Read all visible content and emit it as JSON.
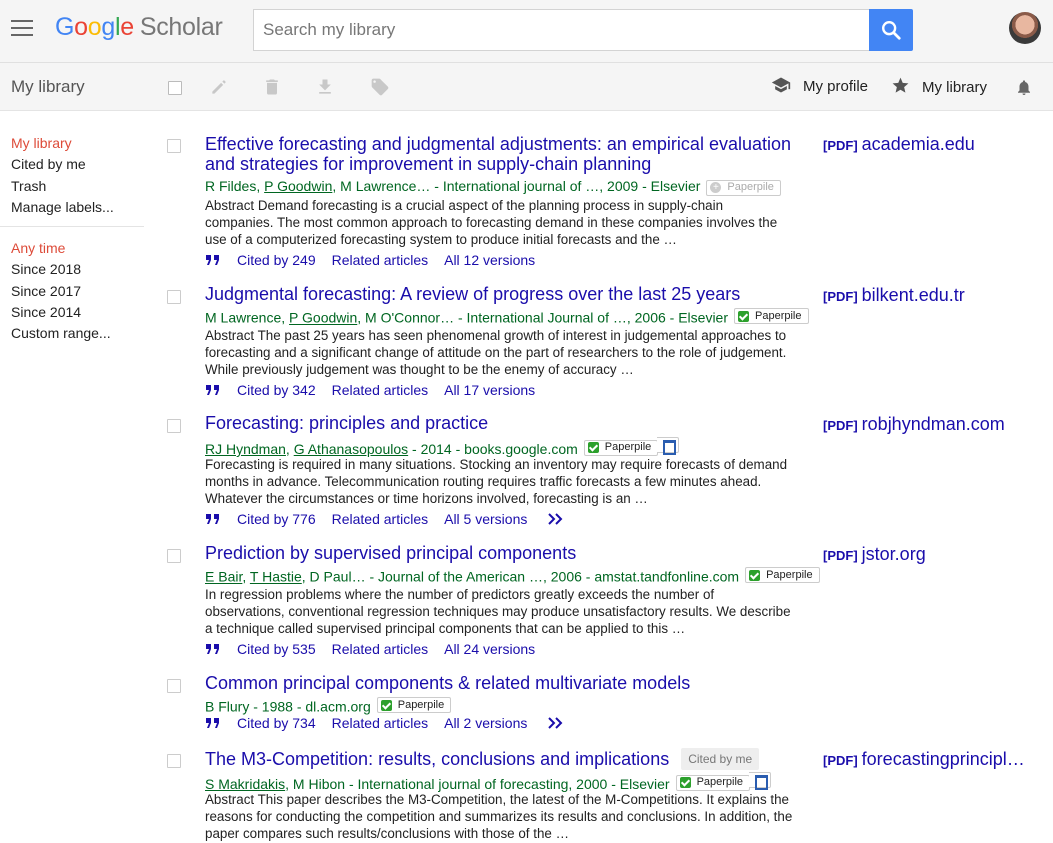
{
  "header": {
    "logo_google": [
      "G",
      "o",
      "o",
      "g",
      "l",
      "e"
    ],
    "logo_scholar": "Scholar",
    "search_placeholder": "Search my library"
  },
  "toolbar": {
    "title": "My library",
    "my_profile": "My profile",
    "my_library": "My library"
  },
  "sidebar": {
    "items": [
      "My library",
      "Cited by me",
      "Trash",
      "Manage labels..."
    ],
    "time_filters": [
      "Any time",
      "Since 2018",
      "Since 2017",
      "Since 2014",
      "Custom range..."
    ]
  },
  "results": [
    {
      "title": "Effective forecasting and judgmental adjustments: an empirical evaluation and strategies for improvement in supply-chain planning",
      "authors_linked": [],
      "meta": [
        "R Fildes, ",
        "P Goodwin",
        ", M Lawrence… - International journal of …, 2009 - Elsevier"
      ],
      "paperpile": {
        "label": "Paperpile",
        "state": "add"
      },
      "snippet": "Abstract Demand forecasting is a crucial aspect of the planning process in supply-chain companies. The most common approach to forecasting demand in these companies involves the use of a computerized forecasting system to produce initial forecasts and the …",
      "cited_by": "Cited by 249",
      "related": "Related articles",
      "versions": "All 12 versions",
      "pdf_tag": "[PDF]",
      "pdf_source": "academia.edu"
    },
    {
      "title": "Judgmental forecasting: A review of progress over the last 25 years",
      "meta": [
        "M Lawrence, ",
        "P Goodwin",
        ", M O'Connor… - International Journal of …, 2006 - Elsevier"
      ],
      "paperpile": {
        "label": "Paperpile",
        "state": "saved"
      },
      "snippet": "Abstract The past 25 years has seen phenomenal growth of interest in judgemental approaches to forecasting and a significant change of attitude on the part of researchers to the role of judgement. While previously judgement was thought to be the enemy of accuracy …",
      "cited_by": "Cited by 342",
      "related": "Related articles",
      "versions": "All 17 versions",
      "pdf_tag": "[PDF]",
      "pdf_source": "bilkent.edu.tr"
    },
    {
      "title": "Forecasting: principles and practice",
      "meta": [
        "RJ Hyndman",
        ", ",
        "G Athanasopoulos",
        " - 2014 - books.google.com"
      ],
      "paperpile": {
        "label": "Paperpile",
        "state": "saved-doc"
      },
      "snippet": "Forecasting is required in many situations. Stocking an inventory may require forecasts of demand months in advance. Telecommunication routing requires traffic forecasts a few minutes ahead. Whatever the circumstances or time horizons involved, forecasting is an …",
      "cited_by": "Cited by 776",
      "related": "Related articles",
      "versions": "All 5 versions",
      "pdf_tag": "[PDF]",
      "pdf_source": "robjhyndman.com"
    },
    {
      "title": "Prediction by supervised principal components",
      "meta": [
        "E Bair",
        ", ",
        "T Hastie",
        ", D Paul… - Journal of the American …, 2006 - amstat.tandfonline.com"
      ],
      "paperpile": {
        "label": "Paperpile",
        "state": "saved"
      },
      "snippet": "In regression problems where the number of predictors greatly exceeds the number of observations, conventional regression techniques may produce unsatisfactory results. We describe a technique called supervised principal components that can be applied to this …",
      "cited_by": "Cited by 535",
      "related": "Related articles",
      "versions": "All 24 versions",
      "pdf_tag": "[PDF]",
      "pdf_source": "jstor.org"
    },
    {
      "title": "Common principal components & related multivariate models",
      "meta": [
        "B Flury - 1988 - dl.acm.org"
      ],
      "paperpile": {
        "label": "Paperpile",
        "state": "saved"
      },
      "snippet": "",
      "cited_by": "Cited by 734",
      "related": "Related articles",
      "versions": "All 2 versions",
      "pdf_tag": "",
      "pdf_source": ""
    },
    {
      "title": "The M3-Competition: results, conclusions and implications",
      "cited_by_me": "Cited by me",
      "meta": [
        "S Makridakis",
        ", M Hibon - International journal of forecasting, 2000 - Elsevier"
      ],
      "paperpile": {
        "label": "Paperpile",
        "state": "saved-doc"
      },
      "snippet": "Abstract This paper describes the M3-Competition, the latest of the M-Competitions. It explains the reasons for conducting the competition and summarizes its results and conclusions. In addition, the paper compares such results/conclusions with those of the …",
      "cited_by": "",
      "related": "",
      "versions": "",
      "pdf_tag": "[PDF]",
      "pdf_source": "forecastingprincipl…"
    }
  ],
  "colors": {
    "link": "#1a0dab",
    "meta_green": "#006621",
    "active_red": "#dd4b39",
    "search_blue": "#4285f4"
  }
}
